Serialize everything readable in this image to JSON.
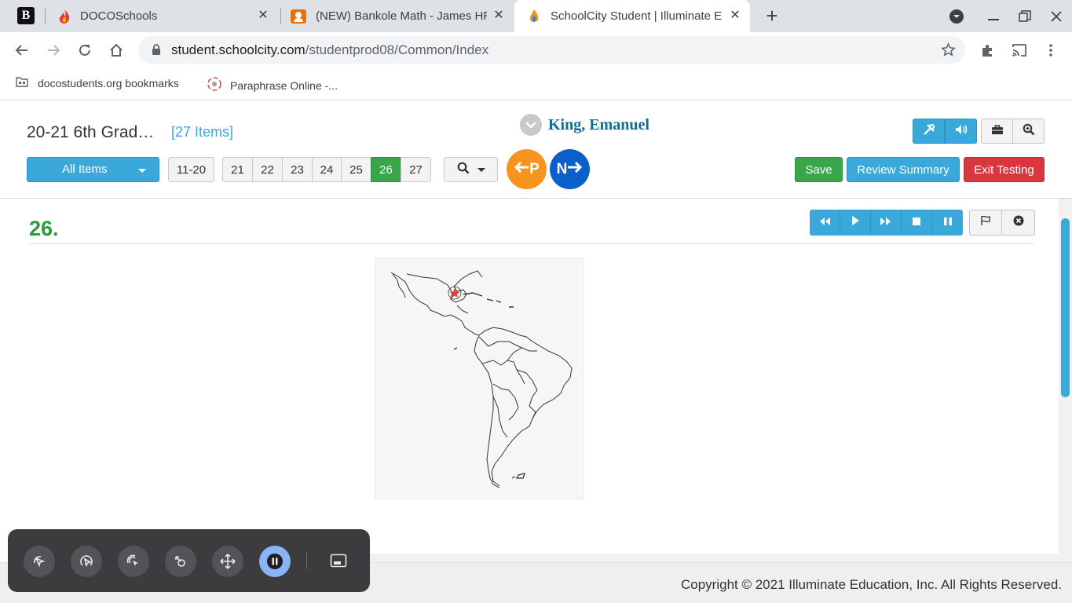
{
  "browser": {
    "tabs": [
      {
        "title": "DOCOSchools",
        "active": false
      },
      {
        "title": "(NEW) Bankole Math - James HR",
        "active": false
      },
      {
        "title": "SchoolCity Student | Illuminate Ed",
        "active": true
      }
    ],
    "url_host": "student.schoolcity.com",
    "url_path": "/studentprod08/Common/Index",
    "bookmarks": [
      {
        "label": "docostudents.org bookmarks",
        "icon": "folder-icon"
      },
      {
        "label": "Paraphrase Online -...",
        "icon": "paraphrase-favicon"
      }
    ]
  },
  "header": {
    "test_title": "20-21 6th Grad…",
    "items_count": "[27 Items]",
    "student_name": "King, Emanuel",
    "filter_label": "All Items",
    "range_button": "11-20",
    "question_buttons": [
      "21",
      "22",
      "23",
      "24",
      "25",
      "26",
      "27"
    ],
    "current_question": "26",
    "prev_label": "P",
    "next_label": "N",
    "save_label": "Save",
    "review_label": "Review Summary",
    "exit_label": "Exit Testing",
    "colors": {
      "blue": "#3aa8d8",
      "green": "#3aa64a",
      "red": "#d9363e",
      "orange": "#f7941d",
      "navy": "#0a5fc8"
    }
  },
  "question": {
    "number": "26.",
    "image_alt": "Map of Latin America with a star marked in Mexico",
    "media_controls": [
      "rewind-icon",
      "play-icon",
      "fast-forward-icon",
      "stop-icon",
      "pause-icon"
    ],
    "flag_icon": "flag-icon",
    "eliminate_icon": "close-circle-icon"
  },
  "footer": {
    "copyright": "Copyright © 2021 Illuminate Education, Inc. All Rights Reserved."
  },
  "a11y_panel": {
    "tools": [
      "auto-click-icon",
      "double-click-icon",
      "right-click-icon",
      "drag-icon",
      "scroll-icon",
      "pause-icon",
      "position-icon"
    ]
  }
}
